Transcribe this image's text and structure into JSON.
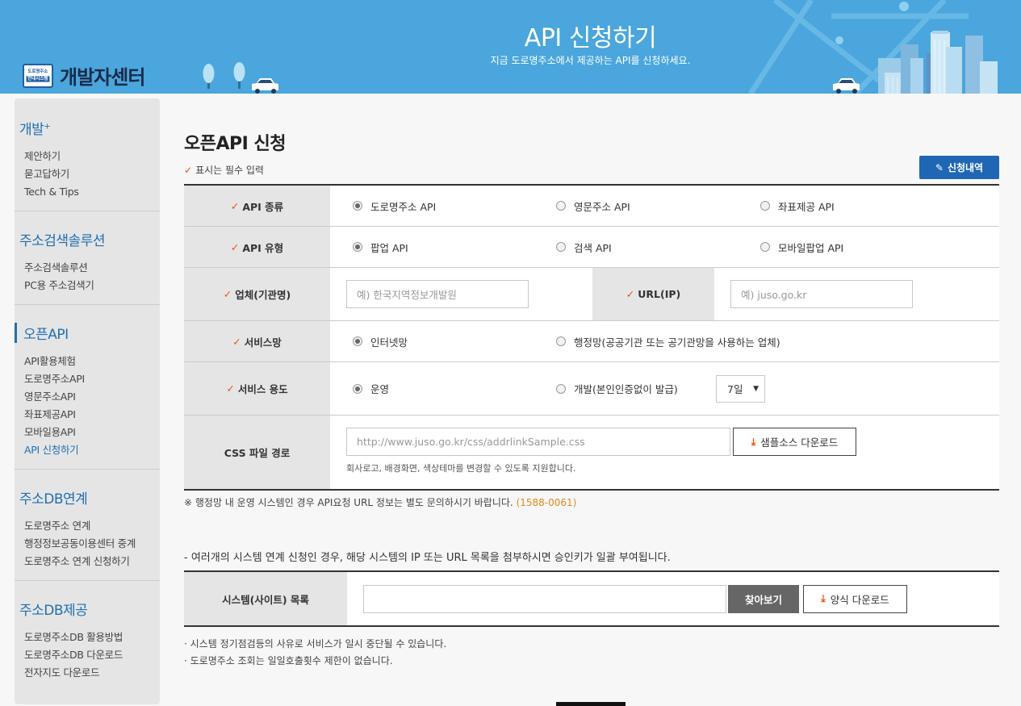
{
  "header": {
    "logo_badge_top": "도로명주소",
    "logo_badge_bottom": "안내시스템",
    "logo_text": "개발자센터",
    "title": "API 신청하기",
    "subtitle": "지금 도로명주소에서 제공하는 API를 신청하세요."
  },
  "sidebar": {
    "sections": [
      {
        "title": "개발",
        "title_sup": "+",
        "items": [
          "제안하기",
          "묻고답하기",
          "Tech & Tips"
        ]
      },
      {
        "title": "주소검색솔루션",
        "items": [
          "주소검색솔루션",
          "PC용 주소검색기"
        ]
      },
      {
        "title": "오픈API",
        "items": [
          "API활용체험",
          "도로명주소API",
          "영문주소API",
          "좌표제공API",
          "모바일용API",
          "API 신청하기"
        ]
      },
      {
        "title": "주소DB연계",
        "items": [
          "도로명주소 연계",
          "행정정보공동이용센터 중계",
          "도로명주소 연계 신청하기"
        ]
      },
      {
        "title": "주소DB제공",
        "items": [
          "도로명주소DB 활용방법",
          "도로명주소DB 다운로드",
          "전자지도 다운로드"
        ]
      }
    ]
  },
  "main": {
    "title": "오픈API 신청",
    "required_note": "표시는 필수 입력",
    "history_button": "신청내역",
    "rows": {
      "api_kind": {
        "label": "API 종류",
        "options": [
          "도로명주소 API",
          "영문주소 API",
          "좌표제공 API"
        ],
        "selected": 0
      },
      "api_type": {
        "label": "API 유형",
        "options": [
          "팝업 API",
          "검색 API",
          "모바일팝업 API"
        ],
        "selected": 0
      },
      "company": {
        "label": "업체(기관명)",
        "placeholder": "예) 한국지역정보개발원"
      },
      "url": {
        "label": "URL(IP)",
        "placeholder": "예) juso.go.kr"
      },
      "network": {
        "label": "서비스망",
        "options": [
          "인터넷망",
          "행정망(공공기관 또는 공기관망을 사용하는 업체)"
        ],
        "selected": 0
      },
      "usage": {
        "label": "서비스 용도",
        "options": [
          "운영",
          "개발(본인인증없이 발급)"
        ],
        "selected": 0,
        "period": "7일"
      },
      "css": {
        "label": "CSS 파일 경로",
        "placeholder": "http://www.juso.go.kr/css/addrlinkSample.css",
        "download_button": "샘플소스 다운로드",
        "help": "회사로고, 배경화면, 색상테마를 변경할 수 있도록 지원합니다."
      }
    },
    "notice_admin": "※ 행정망 내 운영 시스템인 경우 API요청 URL 정보는 별도 문의하시기 바랍니다.",
    "notice_tel": "(1588-0061)",
    "multi_note": "- 여러개의 시스템 연계 신청인 경우, 해당 시스템의 IP 또는 URL 목록을 첨부하시면 승인키가 일괄 부여됩니다.",
    "system_list": {
      "label": "시스템(사이트) 목록",
      "value": "",
      "browse_button": "찾아보기",
      "form_download_button": "양식 다운로드"
    },
    "bullets": [
      "· 시스템 정기점검등의 사유로 서비스가 일시 중단될 수 있습니다.",
      "· 도로명주소 조회는 일일호출횟수 제한이 없습니다."
    ]
  },
  "colors": {
    "header_bg": "#4aa6dc",
    "accent_blue": "#1f67b4",
    "check_orange": "#e8530e",
    "tel_orange": "#e08a1e"
  }
}
